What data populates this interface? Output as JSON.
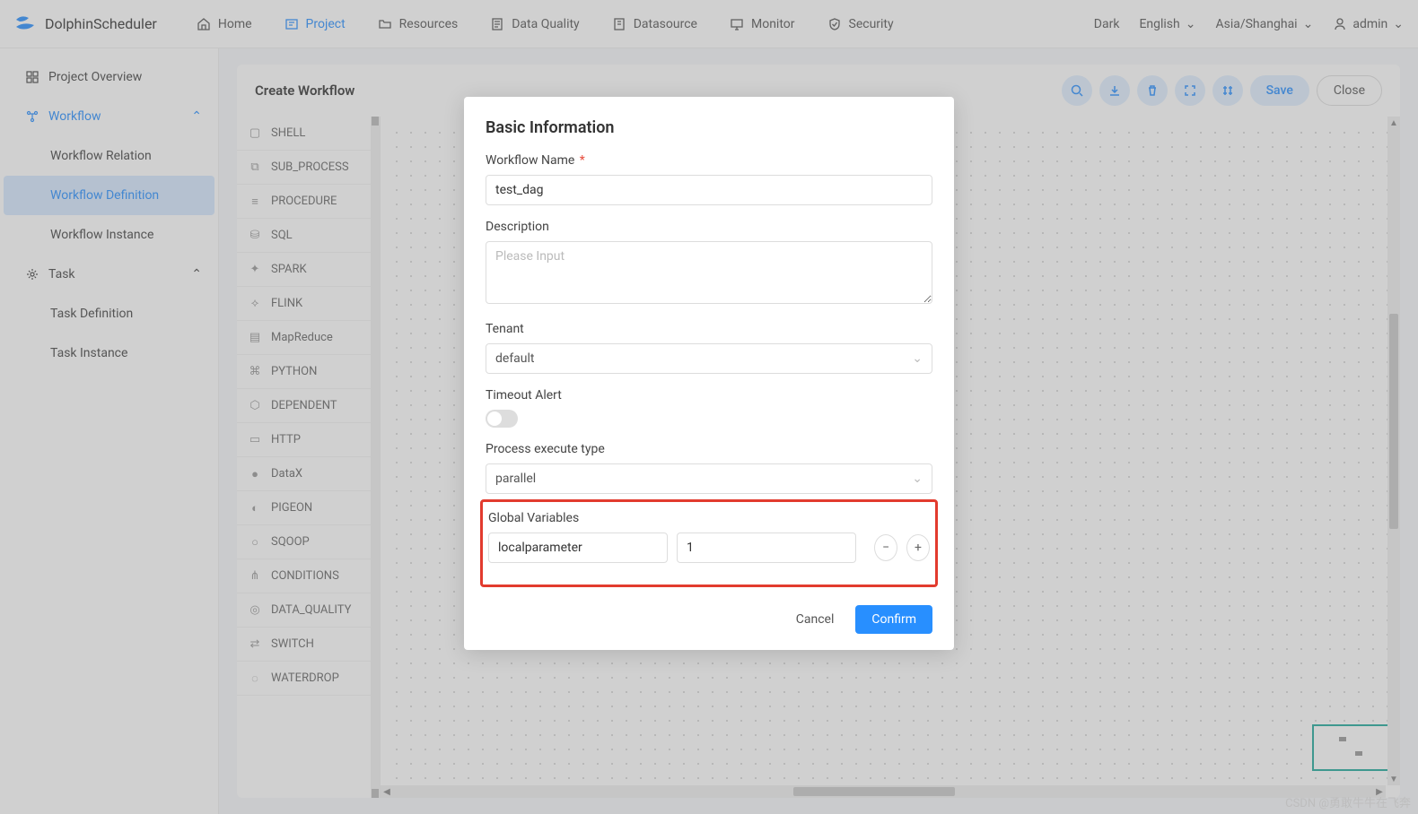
{
  "brand": "DolphinScheduler",
  "nav": {
    "home": "Home",
    "project": "Project",
    "resources": "Resources",
    "data_quality": "Data Quality",
    "datasource": "Datasource",
    "monitor": "Monitor",
    "security": "Security"
  },
  "header_right": {
    "theme": "Dark",
    "language": "English",
    "timezone": "Asia/Shanghai",
    "user": "admin"
  },
  "sidebar": {
    "overview": "Project Overview",
    "workflow": "Workflow",
    "workflow_relation": "Workflow Relation",
    "workflow_definition": "Workflow Definition",
    "workflow_instance": "Workflow Instance",
    "task": "Task",
    "task_definition": "Task Definition",
    "task_instance": "Task Instance"
  },
  "page": {
    "title": "Create Workflow",
    "save": "Save",
    "close": "Close"
  },
  "palette": [
    "SHELL",
    "SUB_PROCESS",
    "PROCEDURE",
    "SQL",
    "SPARK",
    "FLINK",
    "MapReduce",
    "PYTHON",
    "DEPENDENT",
    "HTTP",
    "DataX",
    "PIGEON",
    "SQOOP",
    "CONDITIONS",
    "DATA_QUALITY",
    "SWITCH",
    "WATERDROP"
  ],
  "modal": {
    "title": "Basic Information",
    "workflow_name_label": "Workflow Name",
    "workflow_name_value": "test_dag",
    "description_label": "Description",
    "description_placeholder": "Please Input",
    "tenant_label": "Tenant",
    "tenant_value": "default",
    "timeout_label": "Timeout Alert",
    "exec_type_label": "Process execute type",
    "exec_type_value": "parallel",
    "global_vars_label": "Global Variables",
    "global_var_key": "localparameter",
    "global_var_value": "1",
    "cancel": "Cancel",
    "confirm": "Confirm"
  },
  "watermark": "CSDN @勇敢牛牛在飞奔"
}
